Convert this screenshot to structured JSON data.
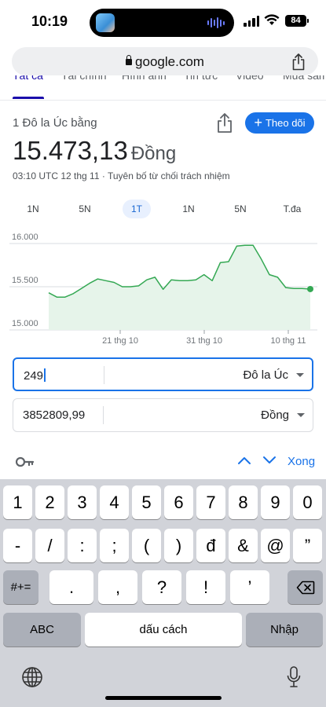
{
  "status_bar": {
    "time": "10:19",
    "battery": "84"
  },
  "browser": {
    "url": "google.com"
  },
  "tabs": [
    {
      "label": "Tất cả",
      "active": true
    },
    {
      "label": "Tài chính"
    },
    {
      "label": "Hình ảnh"
    },
    {
      "label": "Tin tức"
    },
    {
      "label": "Video"
    },
    {
      "label": "Mua sắm"
    }
  ],
  "header": {
    "subtitle": "1 Đô la Úc bằng",
    "rate": "15.473,13",
    "rate_unit": "Đồng",
    "meta": "03:10 UTC 12 thg 11 · Tuyên bố từ chối trách nhiệm",
    "follow_label": "Theo dõi"
  },
  "ranges": [
    {
      "label": "1N"
    },
    {
      "label": "5N"
    },
    {
      "label": "1T",
      "active": true
    },
    {
      "label": "1N"
    },
    {
      "label": "5N"
    },
    {
      "label": "T.đa"
    }
  ],
  "chart_data": {
    "type": "area",
    "y_ticks": [
      "16.000",
      "15.500",
      "15.000"
    ],
    "ylim": [
      15000,
      16000
    ],
    "x_ticks": [
      "21 thg 10",
      "31 thg 10",
      "10 thg 11"
    ],
    "values": [
      15430,
      15380,
      15380,
      15420,
      15480,
      15540,
      15590,
      15570,
      15550,
      15500,
      15500,
      15510,
      15580,
      15610,
      15470,
      15580,
      15570,
      15570,
      15580,
      15640,
      15570,
      15780,
      15790,
      15970,
      15980,
      15980,
      15820,
      15640,
      15610,
      15490,
      15480,
      15480,
      15473
    ],
    "line_color": "#34a853",
    "fill_color": "#e6f4ea"
  },
  "converter": {
    "from": {
      "value": "249",
      "currency": "Đô la Úc"
    },
    "to": {
      "value": "3852809,99",
      "currency": "Đồng"
    }
  },
  "accessory": {
    "done_label": "Xong"
  },
  "keyboard": {
    "row1": [
      "1",
      "2",
      "3",
      "4",
      "5",
      "6",
      "7",
      "8",
      "9",
      "0"
    ],
    "row2": [
      "-",
      "/",
      ":",
      ";",
      "(",
      ")",
      "đ",
      "&",
      "@",
      "”"
    ],
    "row3": [
      ".",
      ",",
      "?",
      "!",
      "’"
    ],
    "mode_key": "#+=",
    "abc_key": "ABC",
    "space_key": "dấu cách",
    "return_key": "Nhập"
  }
}
